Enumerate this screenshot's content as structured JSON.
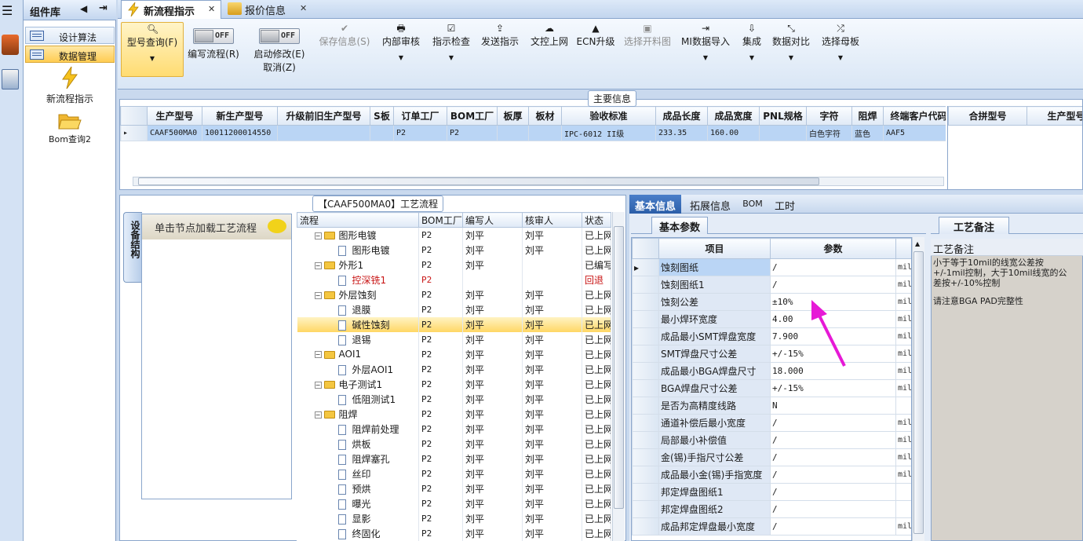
{
  "sidebar": {
    "title": "组件库",
    "groups": [
      "设计算法",
      "数据管理"
    ],
    "tools": [
      "新流程指示",
      "Bom查询2"
    ]
  },
  "tabs": [
    {
      "label": "新流程指示",
      "active": true
    },
    {
      "label": "报价信息",
      "active": false
    }
  ],
  "toolbar": {
    "query": "型号查询(F)",
    "edit_toggle": "OFF",
    "edit_label": "编写流程(R)",
    "start_toggle": "OFF",
    "start_label": "启动修改(E)",
    "cancel_label": "取消(Z)",
    "buttons": [
      "保存信息(S)",
      "内部审核",
      "指示检查",
      "发送指示",
      "文控上网",
      "ECN升级",
      "选择开料图",
      "MI数据导入",
      "集成",
      "数据对比",
      "选择母板"
    ]
  },
  "main_info": {
    "title": "主要信息",
    "columns": [
      "生产型号",
      "新生产型号",
      "升级前旧生产型号",
      "S板",
      "订单工厂",
      "BOM工厂",
      "板厚",
      "板材",
      "验收标准",
      "成品长度",
      "成品宽度",
      "PNL规格",
      "字符",
      "阻焊",
      "终端客户代码"
    ],
    "row": [
      "CAAF500MA0",
      "10011200014550",
      "",
      "",
      "P2",
      "P2",
      "",
      "",
      "IPC-6012 II级",
      "233.35",
      "160.00",
      "",
      "白色字符",
      "蓝色",
      "AAF5"
    ],
    "side_columns": [
      "合拼型号",
      "生产型号"
    ]
  },
  "process": {
    "title": "【CAAF500MA0】工艺流程",
    "vertical_tab": "设备结构",
    "node_hint": "单击节点加载工艺流程",
    "columns": [
      "流程",
      "BOM工厂",
      "编写人",
      "核审人",
      "状态"
    ],
    "rows": [
      {
        "name": "图形电镀",
        "level": 0,
        "factory": "P2",
        "writer": "刘平",
        "reviewer": "刘平",
        "status": "已上网"
      },
      {
        "name": "图形电镀",
        "level": 1,
        "factory": "P2",
        "writer": "刘平",
        "reviewer": "刘平",
        "status": "已上网"
      },
      {
        "name": "外形1",
        "level": 0,
        "factory": "P2",
        "writer": "刘平",
        "reviewer": "",
        "status": "已编写"
      },
      {
        "name": "控深铣1",
        "level": 1,
        "factory": "P2",
        "writer": "",
        "reviewer": "",
        "status": "回退",
        "red": true
      },
      {
        "name": "外层蚀刻",
        "level": 0,
        "factory": "P2",
        "writer": "刘平",
        "reviewer": "刘平",
        "status": "已上网"
      },
      {
        "name": "退膜",
        "level": 1,
        "factory": "P2",
        "writer": "刘平",
        "reviewer": "刘平",
        "status": "已上网"
      },
      {
        "name": "碱性蚀刻",
        "level": 1,
        "factory": "P2",
        "writer": "刘平",
        "reviewer": "刘平",
        "status": "已上网",
        "selected": true
      },
      {
        "name": "退锡",
        "level": 1,
        "factory": "P2",
        "writer": "刘平",
        "reviewer": "刘平",
        "status": "已上网"
      },
      {
        "name": "AOI1",
        "level": 0,
        "factory": "P2",
        "writer": "刘平",
        "reviewer": "刘平",
        "status": "已上网"
      },
      {
        "name": "外层AOI1",
        "level": 1,
        "factory": "P2",
        "writer": "刘平",
        "reviewer": "刘平",
        "status": "已上网"
      },
      {
        "name": "电子测试1",
        "level": 0,
        "factory": "P2",
        "writer": "刘平",
        "reviewer": "刘平",
        "status": "已上网"
      },
      {
        "name": "低阻测试1",
        "level": 1,
        "factory": "P2",
        "writer": "刘平",
        "reviewer": "刘平",
        "status": "已上网"
      },
      {
        "name": "阻焊",
        "level": 0,
        "factory": "P2",
        "writer": "刘平",
        "reviewer": "刘平",
        "status": "已上网"
      },
      {
        "name": "阻焊前处理",
        "level": 1,
        "factory": "P2",
        "writer": "刘平",
        "reviewer": "刘平",
        "status": "已上网"
      },
      {
        "name": "烘板",
        "level": 1,
        "factory": "P2",
        "writer": "刘平",
        "reviewer": "刘平",
        "status": "已上网"
      },
      {
        "name": "阻焊塞孔",
        "level": 1,
        "factory": "P2",
        "writer": "刘平",
        "reviewer": "刘平",
        "status": "已上网"
      },
      {
        "name": "丝印",
        "level": 1,
        "factory": "P2",
        "writer": "刘平",
        "reviewer": "刘平",
        "status": "已上网"
      },
      {
        "name": "预烘",
        "level": 1,
        "factory": "P2",
        "writer": "刘平",
        "reviewer": "刘平",
        "status": "已上网"
      },
      {
        "name": "曝光",
        "level": 1,
        "factory": "P2",
        "writer": "刘平",
        "reviewer": "刘平",
        "status": "已上网"
      },
      {
        "name": "显影",
        "level": 1,
        "factory": "P2",
        "writer": "刘平",
        "reviewer": "刘平",
        "status": "已上网"
      },
      {
        "name": "终固化",
        "level": 1,
        "factory": "P2",
        "writer": "刘平",
        "reviewer": "刘平",
        "status": "已上网"
      }
    ]
  },
  "right_tabs": [
    "基本信息",
    "拓展信息",
    "BOM",
    "工时"
  ],
  "params": {
    "title": "基本参数",
    "columns": [
      "项目",
      "参数"
    ],
    "rows": [
      {
        "name": "蚀刻图纸",
        "value": "/",
        "unit": "mil",
        "selected": true
      },
      {
        "name": "蚀刻图纸1",
        "value": "/",
        "unit": "mil"
      },
      {
        "name": "蚀刻公差",
        "value": "±10%",
        "unit": "mil"
      },
      {
        "name": "最小焊环宽度",
        "value": "4.00",
        "unit": "mil"
      },
      {
        "name": "成品最小SMT焊盘宽度",
        "value": "7.900",
        "unit": "mil"
      },
      {
        "name": "SMT焊盘尺寸公差",
        "value": "+/-15%",
        "unit": "mil"
      },
      {
        "name": "成品最小BGA焊盘尺寸",
        "value": "18.000",
        "unit": "mil"
      },
      {
        "name": "BGA焊盘尺寸公差",
        "value": "+/-15%",
        "unit": "mil"
      },
      {
        "name": "是否为高精度线路",
        "value": "N",
        "unit": ""
      },
      {
        "name": "通道补偿后最小宽度",
        "value": "/",
        "unit": "mil"
      },
      {
        "name": "局部最小补偿值",
        "value": "/",
        "unit": "mil"
      },
      {
        "name": "金(锡)手指尺寸公差",
        "value": "/",
        "unit": "mil"
      },
      {
        "name": "成品最小金(锡)手指宽度",
        "value": "/",
        "unit": "mil"
      },
      {
        "name": "邦定焊盘图纸1",
        "value": "/",
        "unit": ""
      },
      {
        "name": "邦定焊盘图纸2",
        "value": "/",
        "unit": ""
      },
      {
        "name": "成品邦定焊盘最小宽度",
        "value": "/",
        "unit": "mil"
      }
    ]
  },
  "notes": {
    "tab": "工艺备注",
    "title": "工艺备注",
    "line1": "小于等于10mil的线宽公差按+/-1mil控制，大于10mil线宽的公差按+/-10%控制",
    "line2": "请注意BGA PAD完整性"
  }
}
